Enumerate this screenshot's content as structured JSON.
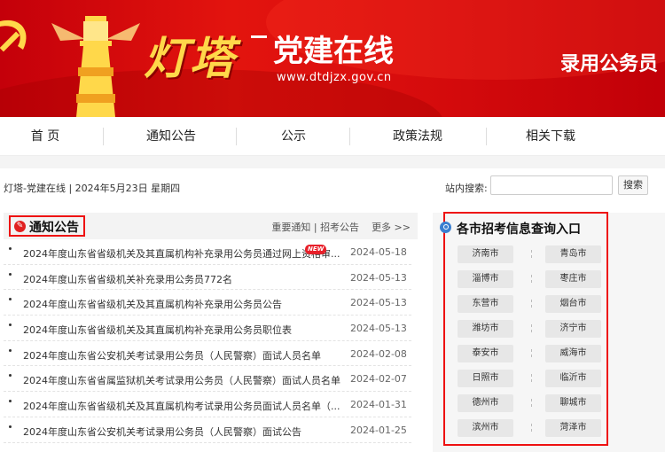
{
  "banner": {
    "logo_title": "灯塔",
    "logo_subtitle": "党建在线",
    "logo_url": "www.dtdjzx.gov.cn",
    "right_text": "录用公务员",
    "colors": {
      "banner_red": "#d80d0d",
      "logo_yellow": "#ffd84a"
    }
  },
  "nav": {
    "items": [
      "首 页",
      "通知公告",
      "公示",
      "政策法规",
      "相关下载"
    ]
  },
  "info_bar": {
    "date_text": "灯塔-党建在线 | 2024年5月23日 星期四",
    "search_label": "站内搜索:",
    "search_value": "",
    "search_button": "搜索"
  },
  "notice": {
    "title": "通知公告",
    "link_important": "重要通知",
    "link_sep": "|",
    "link_exam": "招考公告",
    "link_more": "更多 >>",
    "new_badge": "NEW",
    "items": [
      {
        "title": "2024年度山东省省级机关及其直属机构补充录用公务员通过网上资格审...",
        "date": "2024-05-18",
        "is_new": true
      },
      {
        "title": "2024年度山东省省级机关补充录用公务员772名",
        "date": "2024-05-13"
      },
      {
        "title": "2024年度山东省省级机关及其直属机构补充录用公务员公告",
        "date": "2024-05-13"
      },
      {
        "title": "2024年度山东省省级机关及其直属机构补充录用公务员职位表",
        "date": "2024-05-13"
      },
      {
        "title": "2024年度山东省公安机关考试录用公务员（人民警察）面试人员名单",
        "date": "2024-02-08"
      },
      {
        "title": "2024年度山东省省属监狱机关考试录用公务员（人民警察）面试人员名单",
        "date": "2024-02-07"
      },
      {
        "title": "2024年度山东省省级机关及其直属机构考试录用公务员面试人员名单（...",
        "date": "2024-01-31"
      },
      {
        "title": "2024年度山东省公安机关考试录用公务员（人民警察）面试公告",
        "date": "2024-01-25"
      }
    ]
  },
  "cities": {
    "title": "各市招考信息查询入口",
    "left": [
      "济南市",
      "淄博市",
      "东营市",
      "潍坊市",
      "泰安市",
      "日照市",
      "德州市",
      "滨州市"
    ],
    "right": [
      "青岛市",
      "枣庄市",
      "烟台市",
      "济宁市",
      "威海市",
      "临沂市",
      "聊城市",
      "菏泽市"
    ]
  }
}
